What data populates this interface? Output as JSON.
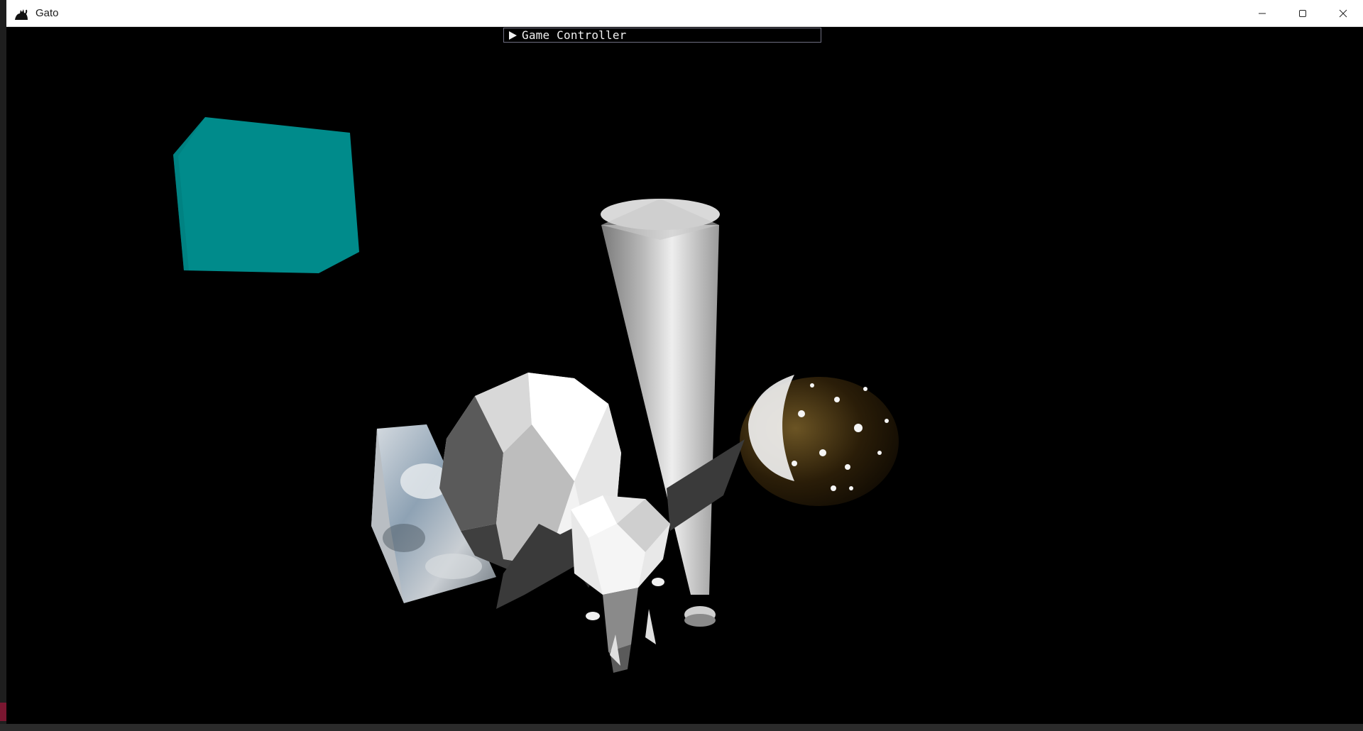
{
  "window": {
    "title": "Gato",
    "icon": "cat-icon",
    "controls": [
      "minimize-icon",
      "maximize-icon",
      "close-icon"
    ]
  },
  "imgui": {
    "panel_label": "Game Controller",
    "collapsed": true,
    "arrow_icon": "triangle-right-icon"
  },
  "scene": {
    "background": "#000000",
    "objects": [
      {
        "name": "teal-cube",
        "color": "#008B8B"
      },
      {
        "name": "cloud-textured-cube",
        "texture": "clouds"
      },
      {
        "name": "low-poly-sphere",
        "color": "#e6e6e6"
      },
      {
        "name": "tapered-column",
        "color": "#d0d0d0"
      },
      {
        "name": "spotted-egg",
        "color": "#3a2a10"
      },
      {
        "name": "bat-creature",
        "color": "#3a3a3a"
      }
    ]
  }
}
